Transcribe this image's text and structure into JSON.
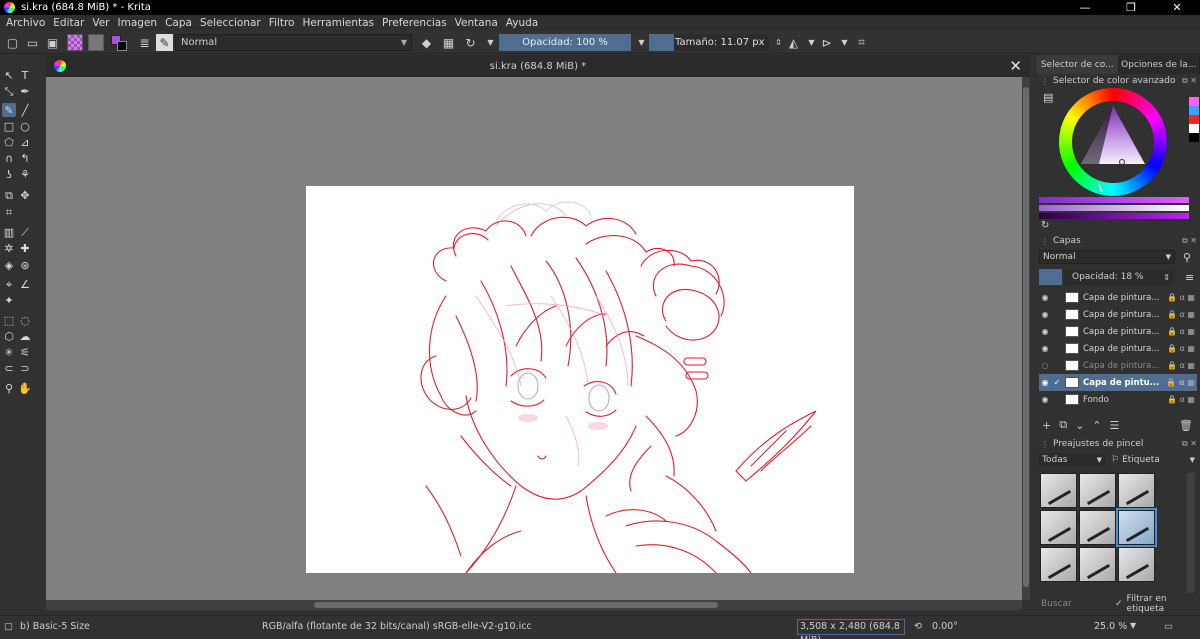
{
  "window": {
    "title": "si.kra (684.8 MiB) * - Krita",
    "controls": {
      "minimize": "—",
      "maximize": "❐",
      "close": "✕"
    }
  },
  "menu": [
    "Archivo",
    "Editar",
    "Ver",
    "Imagen",
    "Capa",
    "Seleccionar",
    "Filtro",
    "Herramientas",
    "Preferencias",
    "Ventana",
    "Ayuda"
  ],
  "toolbar": {
    "blend_mode": "Normal",
    "opacity": "Opacidad: 100 %",
    "opacity_fraction": 1.0,
    "size": "Tamaño: 11.07 px"
  },
  "document": {
    "tab_title": "si.kra (684.8 MiB) *",
    "close_glyph": "✕"
  },
  "dock": {
    "tabs": [
      "Selector de co...",
      "Opciones de la..."
    ],
    "color_panel_title": "Selector de color avanzado",
    "recent_colors": [
      "#ff5fff",
      "#40a0ff",
      "#ff2020",
      "#ffffff",
      "#000000"
    ],
    "layers_title": "Capas",
    "layer_blend": "Normal",
    "layer_opacity": "Opacidad:  18 %",
    "layers": [
      {
        "name": "Capa de pintura...",
        "visible": true,
        "selected": false,
        "dim": false
      },
      {
        "name": "Capa de pintura...",
        "visible": true,
        "selected": false,
        "dim": false
      },
      {
        "name": "Capa de pintura...",
        "visible": true,
        "selected": false,
        "dim": false
      },
      {
        "name": "Capa de pintura...",
        "visible": true,
        "selected": false,
        "dim": false
      },
      {
        "name": "Capa de pintura...",
        "visible": false,
        "selected": false,
        "dim": true
      },
      {
        "name": "Capa de pintu...",
        "visible": true,
        "selected": true,
        "dim": false
      },
      {
        "name": "Fondo",
        "visible": true,
        "selected": false,
        "dim": false
      }
    ],
    "brush_title": "Preajustes de pincel",
    "brush_filter": "Todas",
    "brush_tag": "Etiqueta",
    "brush_search_placeholder": "Buscar",
    "brush_filter_tag": "Filtrar en etiqueta"
  },
  "status": {
    "brush": "b) Basic-5 Size",
    "color_space": "RGB/alfa (flotante de 32 bits/canal)  sRGB-elle-V2-g10.icc",
    "image_size": "3,508 x 2,480 (684.8 MiB)",
    "rotation": "0.00°",
    "zoom": "25.0 %"
  },
  "colors": {
    "accent": "#4e6d91",
    "sketch": "#e01e2c",
    "sketch_light": "#f3a0b4"
  }
}
